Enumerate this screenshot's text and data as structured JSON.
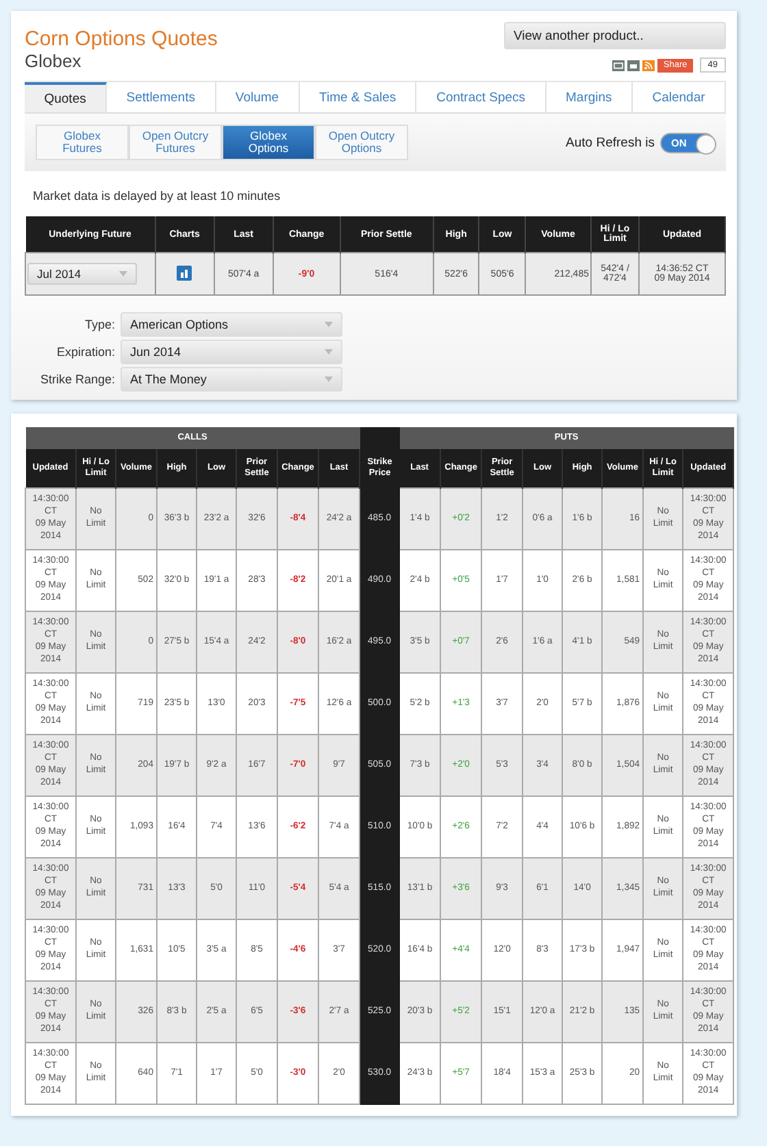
{
  "header": {
    "title": "Corn Options Quotes",
    "subtitle": "Globex",
    "product_select": "View another product..",
    "share_label": "Share",
    "share_count": "49"
  },
  "tabs": [
    {
      "label": "Quotes",
      "selected": true
    },
    {
      "label": "Settlements",
      "selected": false
    },
    {
      "label": "Volume",
      "selected": false
    },
    {
      "label": "Time & Sales",
      "selected": false
    },
    {
      "label": "Contract Specs",
      "selected": false
    },
    {
      "label": "Margins",
      "selected": false
    },
    {
      "label": "Calendar",
      "selected": false
    }
  ],
  "subtabs": [
    {
      "label": "Globex Futures",
      "selected": false
    },
    {
      "label": "Open Outcry Futures",
      "selected": false
    },
    {
      "label": "Globex Options",
      "selected": true
    },
    {
      "label": "Open Outcry Options",
      "selected": false
    }
  ],
  "auto_refresh": {
    "label": "Auto Refresh is",
    "on": true,
    "state_text": "ON"
  },
  "notice": "Market data is delayed by at least 10 minutes",
  "underlying": {
    "columns": [
      "Underlying Future",
      "Charts",
      "Last",
      "Change",
      "Prior Settle",
      "High",
      "Low",
      "Volume",
      "Hi / Lo Limit",
      "Updated"
    ],
    "month": "Jul 2014",
    "last": "507'4 a",
    "change": "-9'0",
    "change_negative": true,
    "prior_settle": "516'4",
    "high": "522'6",
    "low": "505'6",
    "volume": "212,485",
    "limit": "542'4 / 472'4",
    "updated": "14:36:52 CT\n09 May 2014"
  },
  "filters": [
    {
      "label": "Type:",
      "value": "American Options"
    },
    {
      "label": "Expiration:",
      "value": "Jun 2014"
    },
    {
      "label": "Strike Range:",
      "value": "At The Money"
    }
  ],
  "options": {
    "calls_title": "CALLS",
    "puts_title": "PUTS",
    "strike_header": "Strike Price",
    "call_columns": [
      "Updated",
      "Hi / Lo Limit",
      "Volume",
      "High",
      "Low",
      "Prior Settle",
      "Change",
      "Last"
    ],
    "put_columns": [
      "Last",
      "Change",
      "Prior Settle",
      "Low",
      "High",
      "Volume",
      "Hi / Lo Limit",
      "Updated"
    ],
    "rows": [
      {
        "calls": [
          "14:30:00\nCT\n09 May\n2014",
          "No Limit",
          "0",
          "36'3 b",
          "23'2 a",
          "32'6",
          "-8'4",
          "24'2 a"
        ],
        "call_negative": true,
        "strike": "485.0",
        "puts": [
          "1'4 b",
          "+0'2",
          "1'2",
          "0'6 a",
          "1'6 b",
          "16",
          "No Limit",
          "14:30:00\nCT\n09 May\n2014"
        ],
        "put_negative": false
      },
      {
        "calls": [
          "14:30:00\nCT\n09 May\n2014",
          "No Limit",
          "502",
          "32'0 b",
          "19'1 a",
          "28'3",
          "-8'2",
          "20'1 a"
        ],
        "call_negative": true,
        "strike": "490.0",
        "puts": [
          "2'4 b",
          "+0'5",
          "1'7",
          "1'0",
          "2'6 b",
          "1,581",
          "No Limit",
          "14:30:00\nCT\n09 May\n2014"
        ],
        "put_negative": false
      },
      {
        "calls": [
          "14:30:00\nCT\n09 May\n2014",
          "No Limit",
          "0",
          "27'5 b",
          "15'4 a",
          "24'2",
          "-8'0",
          "16'2 a"
        ],
        "call_negative": true,
        "strike": "495.0",
        "puts": [
          "3'5 b",
          "+0'7",
          "2'6",
          "1'6 a",
          "4'1 b",
          "549",
          "No Limit",
          "14:30:00\nCT\n09 May\n2014"
        ],
        "put_negative": false
      },
      {
        "calls": [
          "14:30:00\nCT\n09 May\n2014",
          "No Limit",
          "719",
          "23'5 b",
          "13'0",
          "20'3",
          "-7'5",
          "12'6 a"
        ],
        "call_negative": true,
        "strike": "500.0",
        "puts": [
          "5'2 b",
          "+1'3",
          "3'7",
          "2'0",
          "5'7 b",
          "1,876",
          "No Limit",
          "14:30:00\nCT\n09 May\n2014"
        ],
        "put_negative": false
      },
      {
        "calls": [
          "14:30:00\nCT\n09 May\n2014",
          "No Limit",
          "204",
          "19'7 b",
          "9'2 a",
          "16'7",
          "-7'0",
          "9'7"
        ],
        "call_negative": true,
        "strike": "505.0",
        "puts": [
          "7'3 b",
          "+2'0",
          "5'3",
          "3'4",
          "8'0 b",
          "1,504",
          "No Limit",
          "14:30:00\nCT\n09 May\n2014"
        ],
        "put_negative": false
      },
      {
        "calls": [
          "14:30:00\nCT\n09 May\n2014",
          "No Limit",
          "1,093",
          "16'4",
          "7'4",
          "13'6",
          "-6'2",
          "7'4 a"
        ],
        "call_negative": true,
        "strike": "510.0",
        "puts": [
          "10'0 b",
          "+2'6",
          "7'2",
          "4'4",
          "10'6 b",
          "1,892",
          "No Limit",
          "14:30:00\nCT\n09 May\n2014"
        ],
        "put_negative": false
      },
      {
        "calls": [
          "14:30:00\nCT\n09 May\n2014",
          "No Limit",
          "731",
          "13'3",
          "5'0",
          "11'0",
          "-5'4",
          "5'4 a"
        ],
        "call_negative": true,
        "strike": "515.0",
        "puts": [
          "13'1 b",
          "+3'6",
          "9'3",
          "6'1",
          "14'0",
          "1,345",
          "No Limit",
          "14:30:00\nCT\n09 May\n2014"
        ],
        "put_negative": false
      },
      {
        "calls": [
          "14:30:00\nCT\n09 May\n2014",
          "No Limit",
          "1,631",
          "10'5",
          "3'5 a",
          "8'5",
          "-4'6",
          "3'7"
        ],
        "call_negative": true,
        "strike": "520.0",
        "puts": [
          "16'4 b",
          "+4'4",
          "12'0",
          "8'3",
          "17'3 b",
          "1,947",
          "No Limit",
          "14:30:00\nCT\n09 May\n2014"
        ],
        "put_negative": false
      },
      {
        "calls": [
          "14:30:00\nCT\n09 May\n2014",
          "No Limit",
          "326",
          "8'3 b",
          "2'5 a",
          "6'5",
          "-3'6",
          "2'7 a"
        ],
        "call_negative": true,
        "strike": "525.0",
        "puts": [
          "20'3 b",
          "+5'2",
          "15'1",
          "12'0 a",
          "21'2 b",
          "135",
          "No Limit",
          "14:30:00\nCT\n09 May\n2014"
        ],
        "put_negative": false
      },
      {
        "calls": [
          "14:30:00\nCT\n09 May\n2014",
          "No Limit",
          "640",
          "7'1",
          "1'7",
          "5'0",
          "-3'0",
          "2'0"
        ],
        "call_negative": true,
        "strike": "530.0",
        "puts": [
          "24'3 b",
          "+5'7",
          "18'4",
          "15'3 a",
          "25'3 b",
          "20",
          "No Limit",
          "14:30:00\nCT\n09 May\n2014"
        ],
        "put_negative": false
      }
    ]
  }
}
